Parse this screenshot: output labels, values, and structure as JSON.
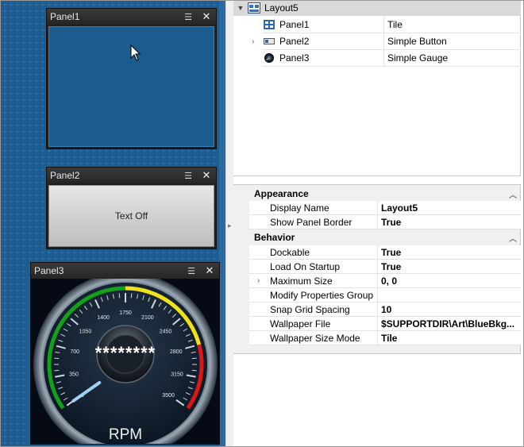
{
  "panels": [
    {
      "title": "Panel1"
    },
    {
      "title": "Panel2",
      "button_text": "Text Off"
    },
    {
      "title": "Panel3"
    }
  ],
  "gauge": {
    "ticks": [
      "0",
      "350",
      "700",
      "1050",
      "1400",
      "1750",
      "2100",
      "2450",
      "2800",
      "3150",
      "3500"
    ],
    "display": "********",
    "unit": "RPM",
    "value": 0,
    "colors": {
      "green": "#13a01a",
      "yellow": "#f0e21a",
      "red": "#e01515",
      "needle": "#9fd0f0"
    }
  },
  "tree": {
    "root": "Layout5",
    "rows": [
      {
        "name": "Panel1",
        "type": "Tile",
        "icon": "tile-icon"
      },
      {
        "name": "Panel2",
        "type": "Simple Button",
        "icon": "button-icon",
        "expandable": true
      },
      {
        "name": "Panel3",
        "type": "Simple Gauge",
        "icon": "gauge-icon"
      }
    ]
  },
  "properties": {
    "categories": [
      {
        "label": "Appearance",
        "rows": [
          {
            "name": "Display Name",
            "value": "Layout5"
          },
          {
            "name": "Show Panel Border",
            "value": "True"
          }
        ]
      },
      {
        "label": "Behavior",
        "rows": [
          {
            "name": "Dockable",
            "value": "True"
          },
          {
            "name": "Load On Startup",
            "value": "True"
          },
          {
            "name": "Maximum Size",
            "value": "0, 0",
            "expandable": true
          },
          {
            "name": "Modify Properties Group",
            "value": ""
          },
          {
            "name": "Snap Grid Spacing",
            "value": "10"
          },
          {
            "name": "Wallpaper File",
            "value": "$SUPPORTDIR\\Art\\BlueBkg..."
          },
          {
            "name": "Wallpaper Size Mode",
            "value": "Tile"
          }
        ]
      }
    ]
  }
}
